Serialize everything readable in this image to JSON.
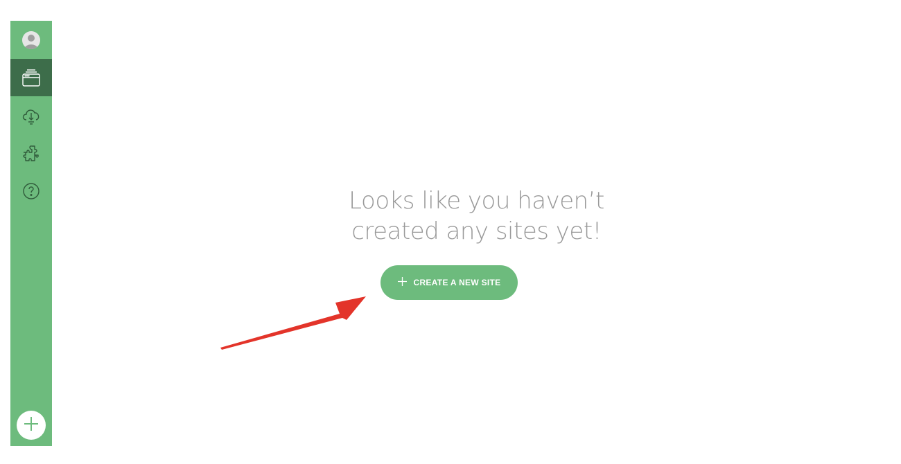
{
  "sidebar": {
    "items": [
      {
        "name": "avatar",
        "icon": "user-avatar-icon"
      },
      {
        "name": "sites",
        "icon": "sites-browser-icon",
        "active": true
      },
      {
        "name": "cloud",
        "icon": "cloud-download-icon"
      },
      {
        "name": "extensions",
        "icon": "puzzle-icon"
      },
      {
        "name": "help",
        "icon": "question-icon"
      }
    ],
    "add_icon": "plus-icon"
  },
  "main": {
    "empty_title_line1": "Looks like you haven’t",
    "empty_title_line2": "created any sites yet!",
    "create_button_label": "CREATE A NEW SITE",
    "create_button_icon": "plus-icon"
  },
  "colors": {
    "sidebar": "#6dbb7d",
    "sidebar_active": "#3d6d4a",
    "button": "#6dbb7d",
    "title_text": "#999999",
    "annotation_arrow": "#e3342a"
  }
}
